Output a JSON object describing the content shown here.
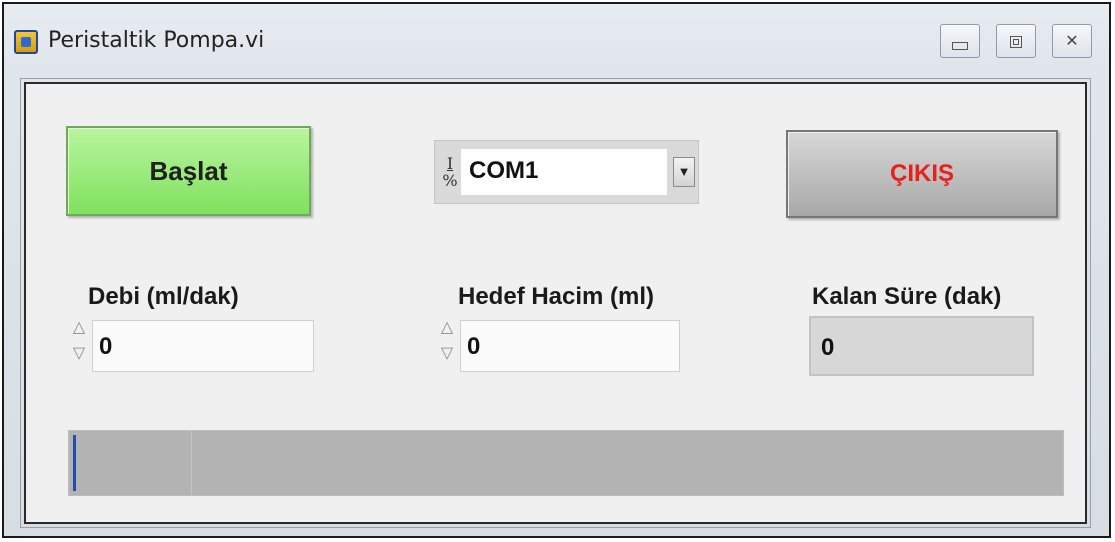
{
  "window": {
    "title": "Peristaltik Pompa.vi",
    "controls": {
      "minimize": "",
      "maximize": "",
      "close": "✕"
    }
  },
  "controls": {
    "start_label": "Başlat",
    "serial_port": {
      "io_icon": "I/O",
      "value": "COM1"
    },
    "exit_label": "ÇIKIŞ"
  },
  "fields": {
    "flow_rate": {
      "label": "Debi (ml/dak)",
      "value": "0"
    },
    "target_volume": {
      "label": "Hedef Hacim (ml)",
      "value": "0"
    },
    "remaining_time": {
      "label": "Kalan Süre (dak)",
      "value": "0"
    }
  },
  "progress": {
    "fraction": 0.0
  },
  "colors": {
    "start_button": "#8fe66c",
    "exit_text": "#e8201b",
    "progress_track": "#b3b3b3",
    "progress_fill": "#1f4fa6"
  },
  "icons": {
    "app": "labview-vi-icon",
    "dropdown": "triangle-down-icon",
    "stepper": "increment-decrement-icon"
  }
}
